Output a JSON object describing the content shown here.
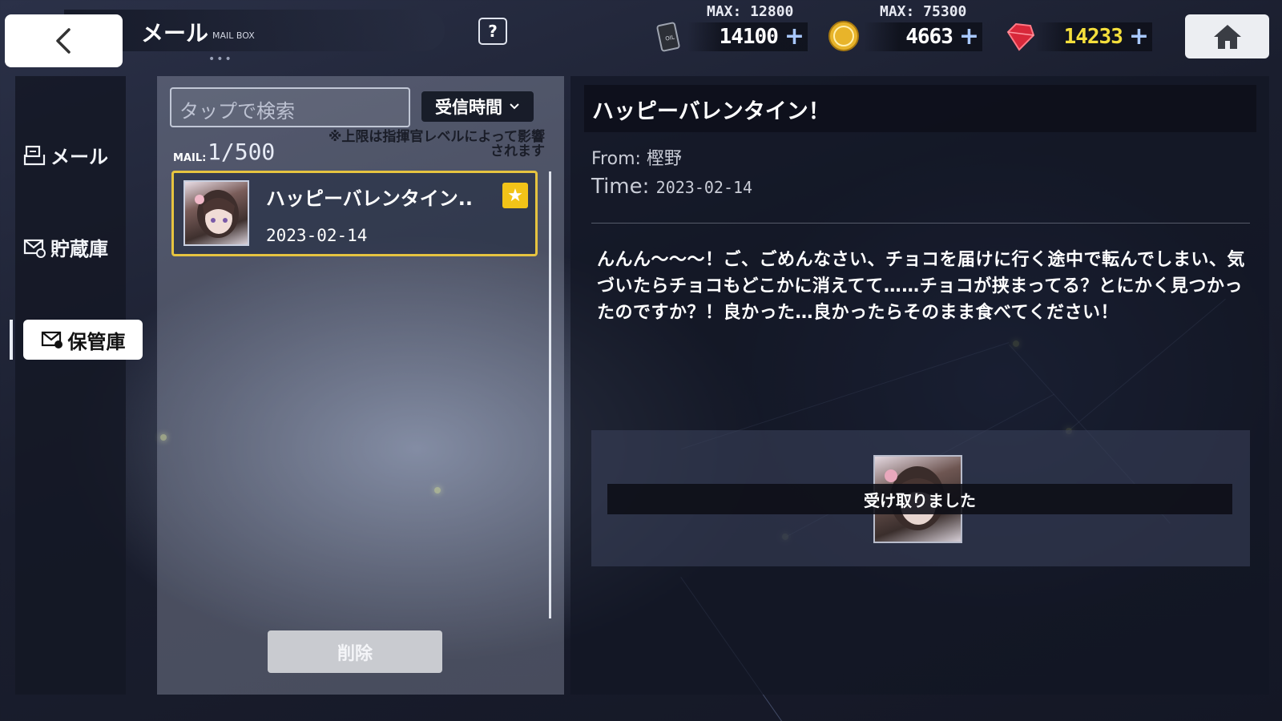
{
  "header": {
    "title": "メール",
    "subtitle": "MAIL BOX",
    "help_label": "?",
    "dots": "•••"
  },
  "resources": {
    "oil": {
      "max": "MAX: 12800",
      "value": "14100",
      "icon": "oil-barrel-icon"
    },
    "coin": {
      "max": "MAX: 75300",
      "value": "4663",
      "icon": "gold-coin-icon"
    },
    "gem": {
      "value": "14233",
      "icon": "red-gem-icon",
      "color": "#f4de3c"
    },
    "plus": "+"
  },
  "sidebar": {
    "items": [
      {
        "label": "メール",
        "icon": "mail-inbox-icon"
      },
      {
        "label": "貯蔵庫",
        "icon": "mail-storage-icon"
      },
      {
        "label": "保管庫",
        "icon": "mail-archive-icon",
        "active": true
      }
    ]
  },
  "list": {
    "search_placeholder": "タップで検索",
    "sort_label": "受信時間",
    "mail_label": "MAIL:",
    "mail_count": "1/500",
    "limit_note": "※上限は指揮官レベルによって影響されます",
    "items": [
      {
        "title": "ハッピーバレンタイン..",
        "date": "2023-02-14",
        "starred": true
      }
    ],
    "delete_label": "削除"
  },
  "detail": {
    "title": "ハッピーバレンタイン！",
    "from_label": "From:",
    "from_value": "樫野",
    "time_label": "Time:",
    "time_value": "2023-02-14",
    "body": "んんん～～～！ご、ごめんなさい、チョコを届けに行く途中で転んでしまい、気づいたらチョコもどこかに消えてて……チョコが挟まってる？とにかく見つかったのですか？！良かった…良かったらそのまま食べてください！",
    "attachment_status": "受け取りました"
  },
  "colors": {
    "accent_gold": "#e6c440",
    "star": "#f2c318",
    "plus_blue": "#a8c8ff"
  }
}
